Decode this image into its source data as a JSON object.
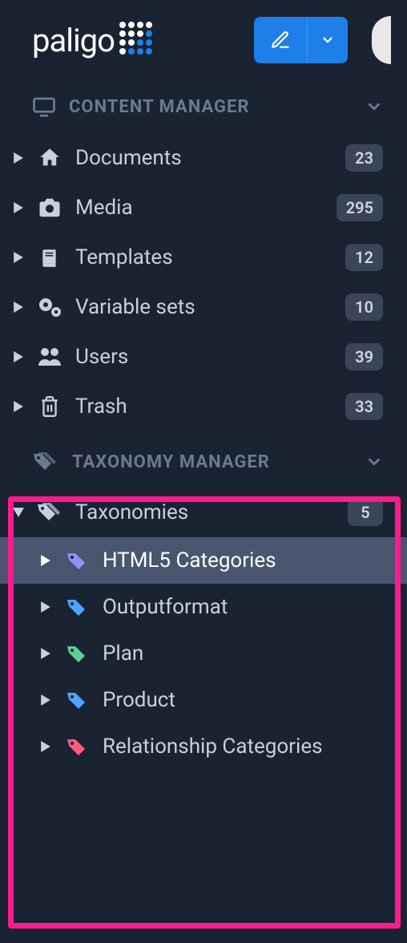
{
  "brand": "paligo",
  "content_manager": {
    "title": "CONTENT MANAGER",
    "items": [
      {
        "label": "Documents",
        "count": "23"
      },
      {
        "label": "Media",
        "count": "295"
      },
      {
        "label": "Templates",
        "count": "12"
      },
      {
        "label": "Variable sets",
        "count": "10"
      },
      {
        "label": "Users",
        "count": "39"
      },
      {
        "label": "Trash",
        "count": "33"
      }
    ]
  },
  "taxonomy_manager": {
    "title": "TAXONOMY MANAGER",
    "root": {
      "label": "Taxonomies",
      "count": "5"
    },
    "items": [
      {
        "label": "HTML5 Categories",
        "color": "#9a8cff",
        "selected": true
      },
      {
        "label": "Outputformat",
        "color": "#4fa4ff",
        "selected": false
      },
      {
        "label": "Plan",
        "color": "#5fcf8f",
        "selected": false
      },
      {
        "label": "Product",
        "color": "#4fa4ff",
        "selected": false
      },
      {
        "label": "Relationship Categories",
        "color": "#ff5a7a",
        "selected": false
      }
    ]
  }
}
